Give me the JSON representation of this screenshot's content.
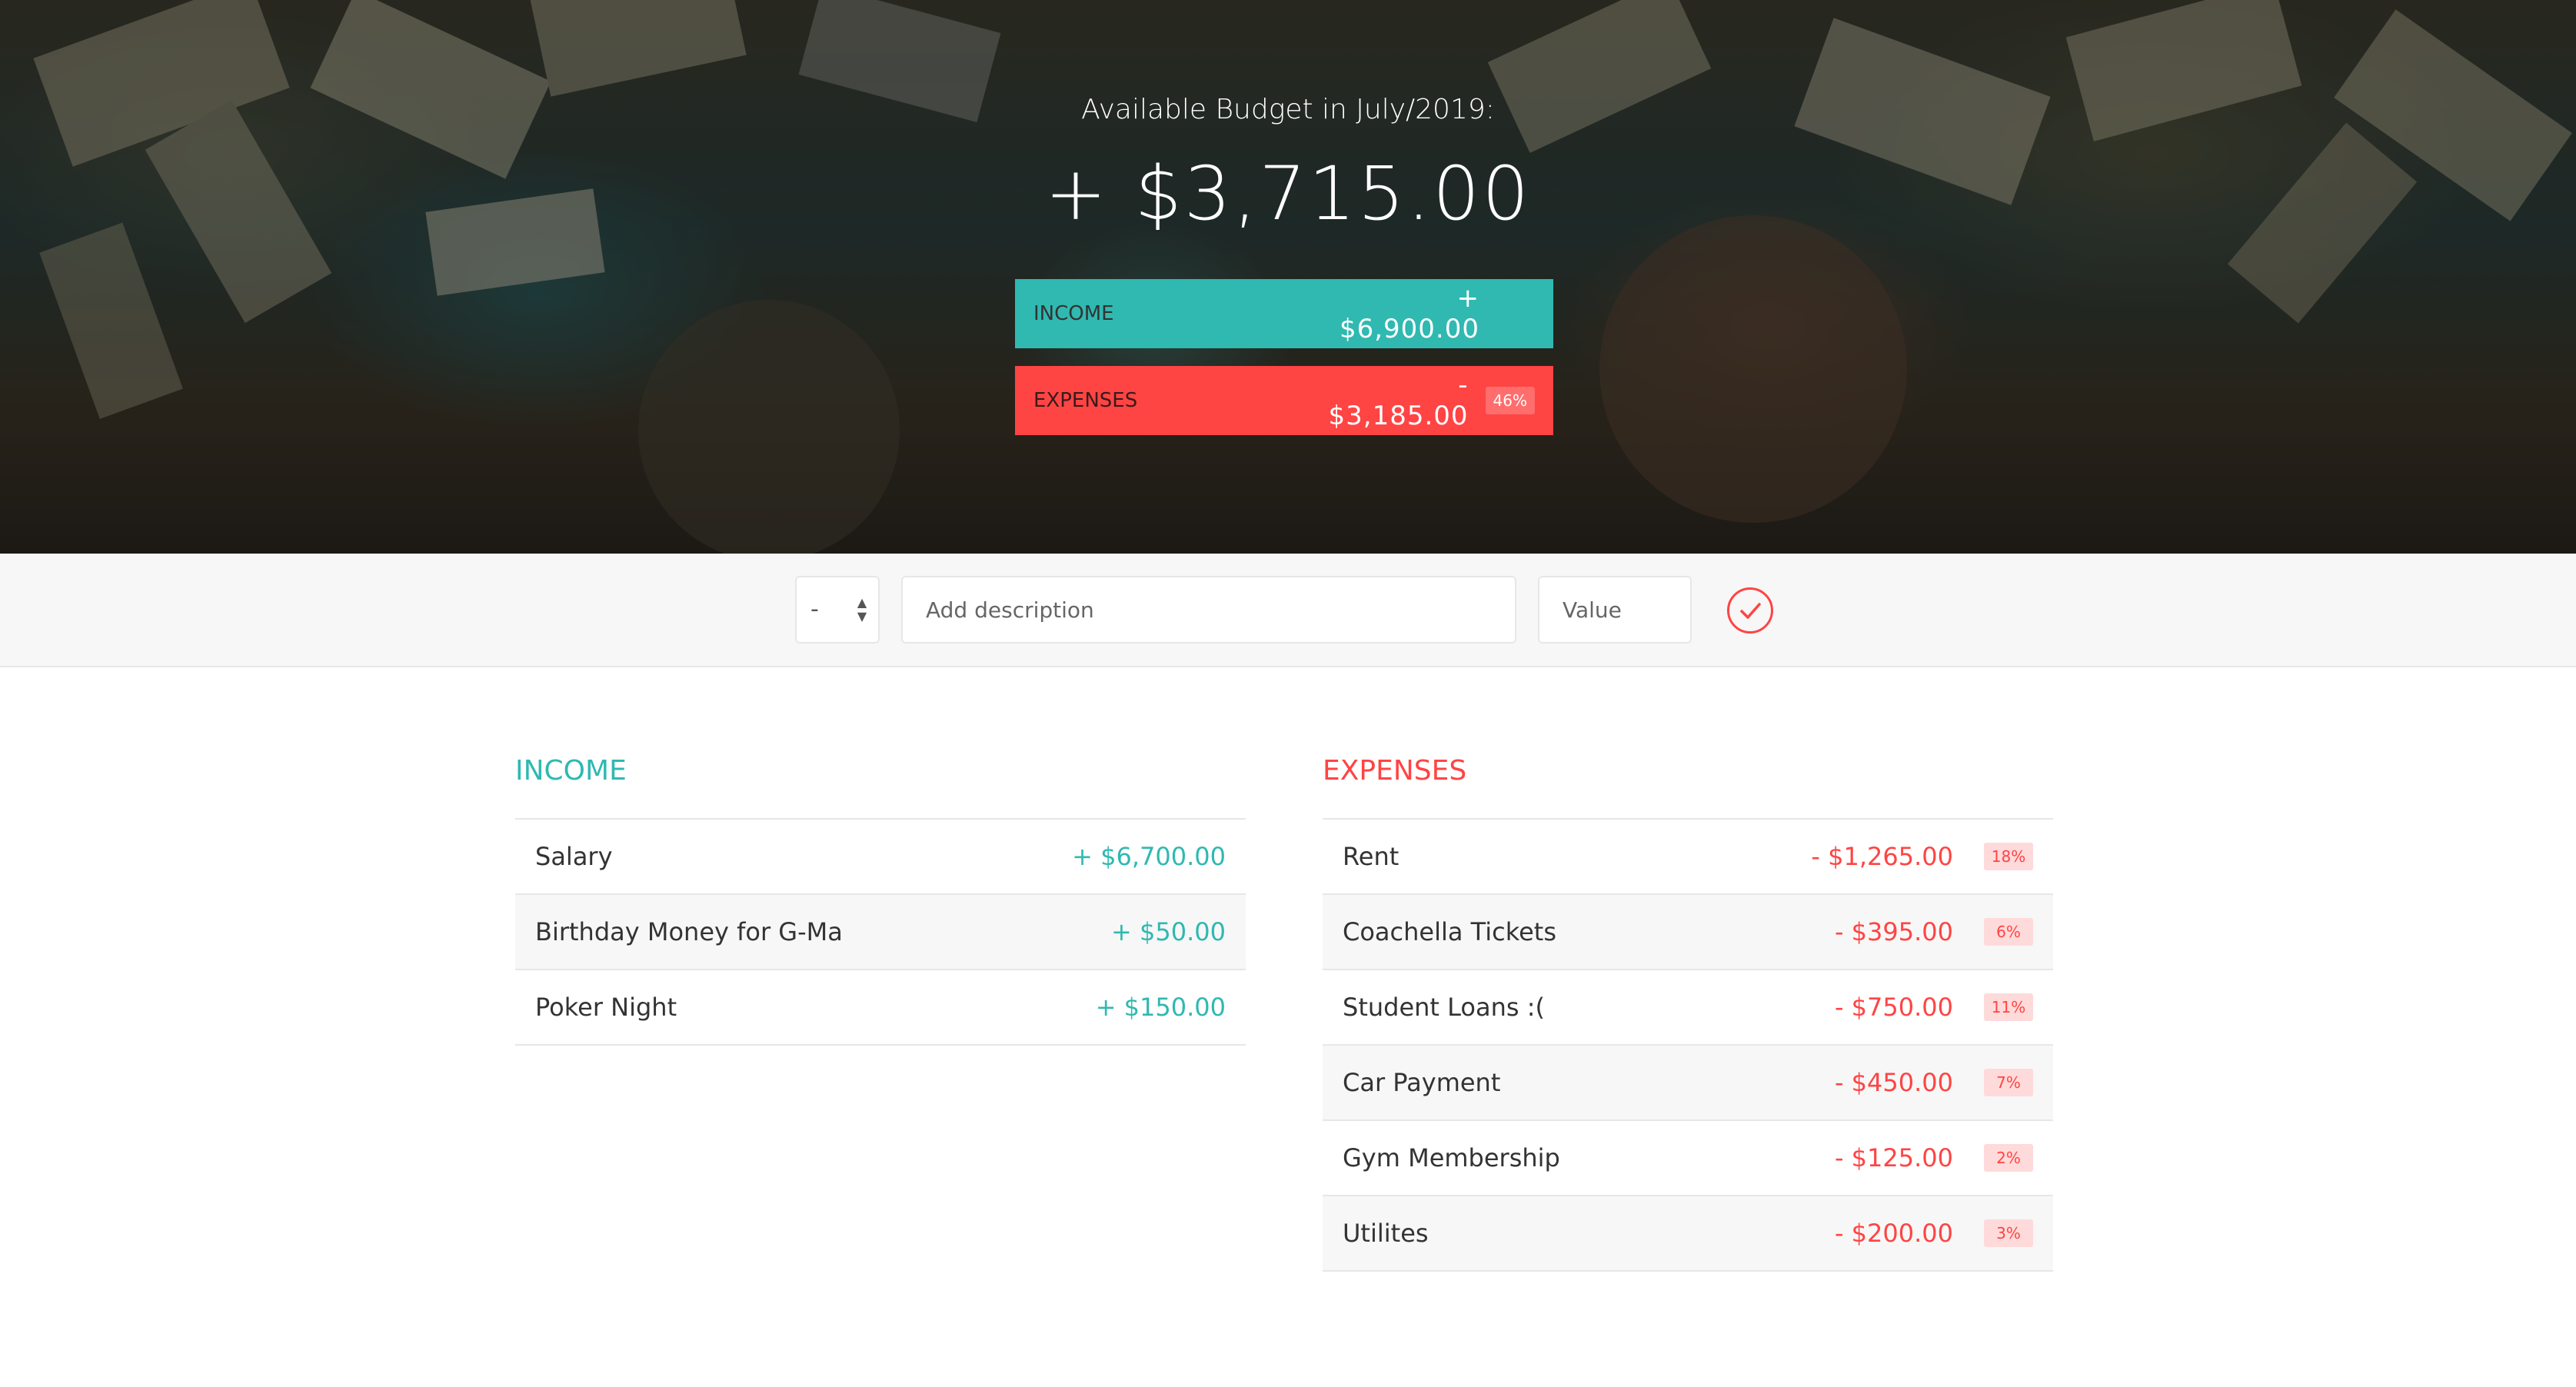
{
  "header": {
    "title": "Available Budget in July/2019:",
    "budget": "+ $3,715.00",
    "income_label": "Income",
    "income_value": "+ $6,900.00",
    "expenses_label": "Expenses",
    "expenses_value": "- $3,185.00",
    "expenses_percentage": "46%"
  },
  "add_form": {
    "type_value": "-",
    "description_placeholder": "Add description",
    "value_placeholder": "Value"
  },
  "income": {
    "title": "Income",
    "items": [
      {
        "description": "Salary",
        "value": "+ $6,700.00"
      },
      {
        "description": "Birthday Money for G-Ma",
        "value": "+ $50.00"
      },
      {
        "description": "Poker Night",
        "value": "+ $150.00"
      }
    ]
  },
  "expenses": {
    "title": "Expenses",
    "items": [
      {
        "description": "Rent",
        "value": "- $1,265.00",
        "percentage": "18%"
      },
      {
        "description": "Coachella Tickets",
        "value": "- $395.00",
        "percentage": "6%"
      },
      {
        "description": "Student Loans :(",
        "value": "- $750.00",
        "percentage": "11%"
      },
      {
        "description": "Car Payment",
        "value": "- $450.00",
        "percentage": "7%"
      },
      {
        "description": "Gym Membership",
        "value": "- $125.00",
        "percentage": "2%"
      },
      {
        "description": "Utilites",
        "value": "- $200.00",
        "percentage": "3%"
      }
    ]
  },
  "colors": {
    "income": "#2fb9b1",
    "expenses": "#ff4444"
  },
  "icons": {
    "add_button": "checkmark-circle-icon",
    "type_select": "up-down-arrows-icon"
  }
}
